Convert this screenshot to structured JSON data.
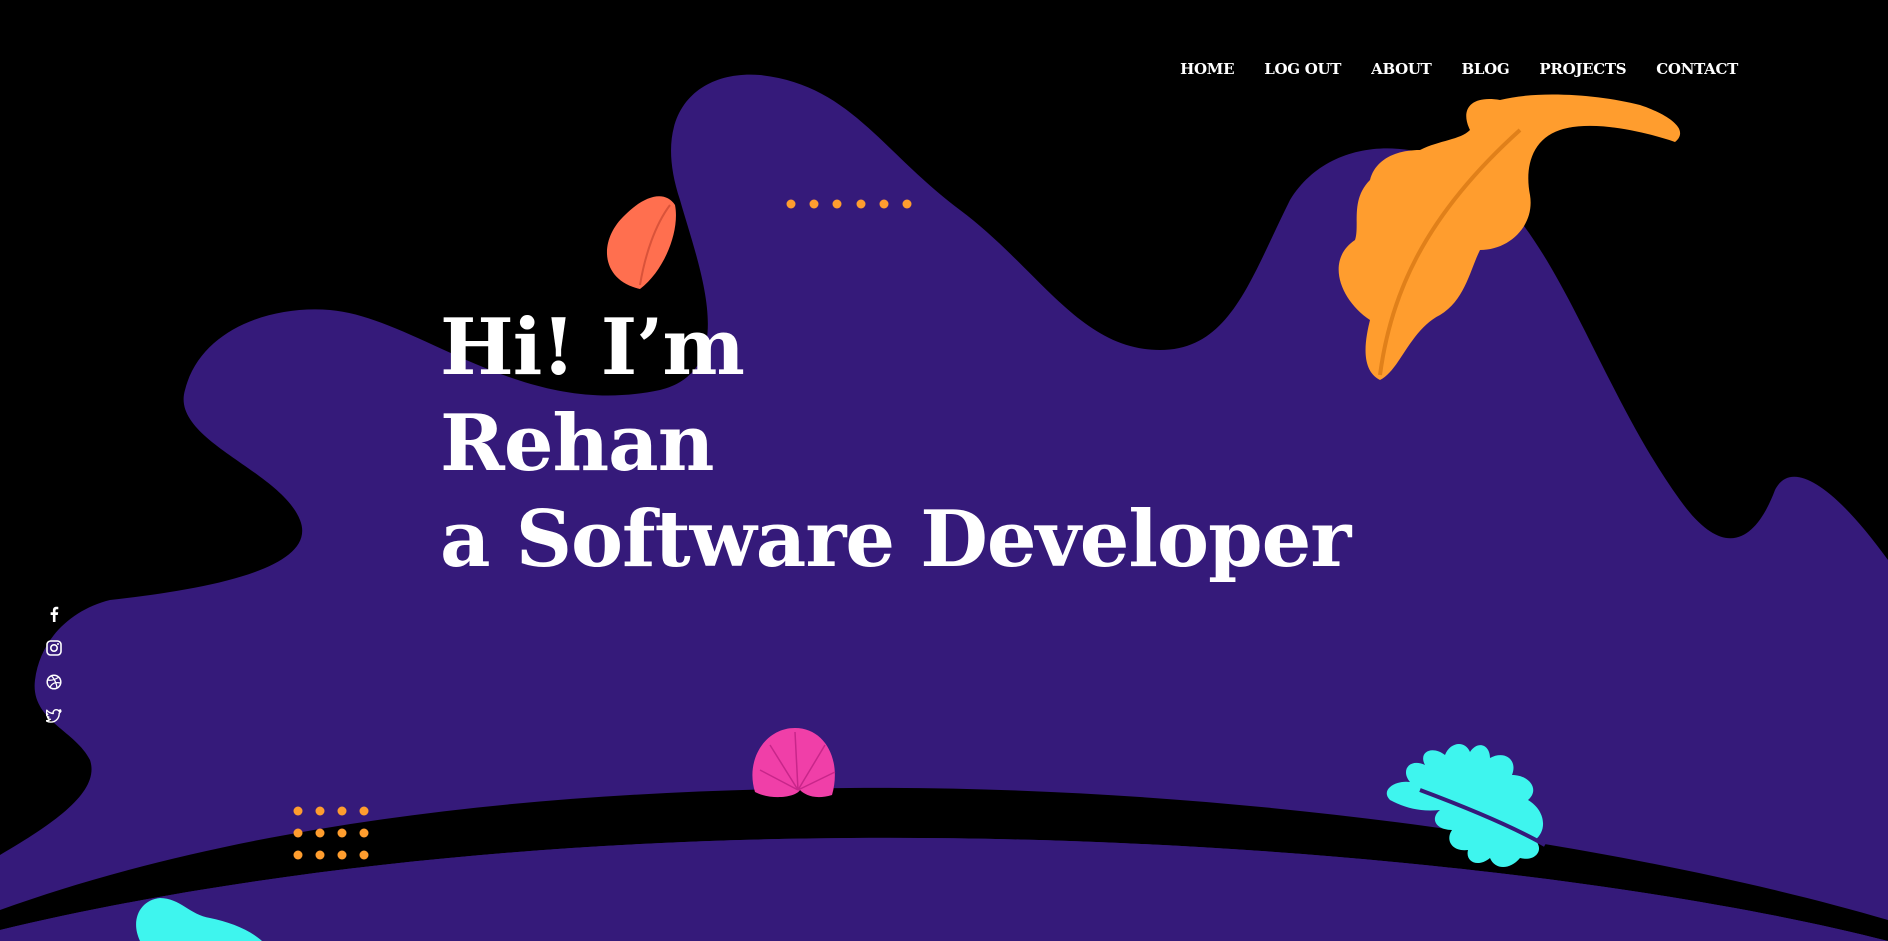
{
  "nav": {
    "items": [
      {
        "label": "HOME"
      },
      {
        "label": "LOG OUT"
      },
      {
        "label": "ABOUT"
      },
      {
        "label": "BLOG"
      },
      {
        "label": "PROJECTS"
      },
      {
        "label": "CONTACT"
      }
    ]
  },
  "hero": {
    "line1": "Hi! I’m",
    "line2": "Rehan",
    "line3": "a Software Developer"
  },
  "social": {
    "icons": [
      "facebook-icon",
      "instagram-icon",
      "dribbble-icon",
      "twitter-icon"
    ]
  },
  "colors": {
    "background": "#000000",
    "blob": "#351a7a",
    "text": "#ffffff",
    "leaf_orange": "#ff9d2e",
    "leaf_coral": "#ff6f4f",
    "leaf_cyan": "#3ef5ee",
    "shell_pink": "#f03fa8",
    "dots": "#ff9d2e"
  }
}
